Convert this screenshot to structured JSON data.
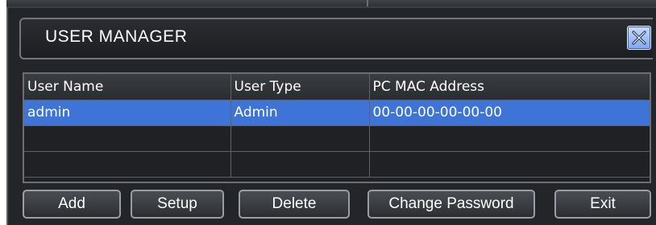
{
  "window": {
    "title": "USER MANAGER"
  },
  "icons": {
    "close": "close-icon"
  },
  "colors": {
    "window_bg": "#232528",
    "selection": "#3e73d8",
    "text": "#ffffff",
    "close_button": "#9bbcf3"
  },
  "table": {
    "headers": [
      "User Name",
      "User Type",
      "PC MAC Address"
    ],
    "rows": [
      [
        "admin",
        "Admin",
        "00-00-00-00-00-00"
      ],
      [
        "",
        "",
        ""
      ],
      [
        "",
        "",
        ""
      ]
    ],
    "selected_row": 0
  },
  "buttons": {
    "add": "Add",
    "setup": "Setup",
    "delete": "Delete",
    "change_password": "Change Password",
    "exit": "Exit"
  }
}
